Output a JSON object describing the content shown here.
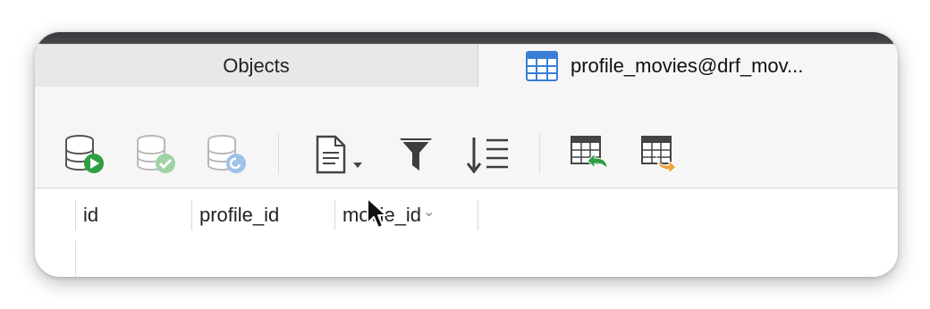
{
  "tabs": [
    {
      "label": "Objects",
      "active": false
    },
    {
      "label": "profile_movies@drf_mov...",
      "active": true,
      "icon": "table-grid-icon"
    }
  ],
  "toolbar": {
    "buttons": [
      {
        "name": "begin-transaction",
        "icon": "database-play-icon"
      },
      {
        "name": "commit",
        "icon": "database-check-icon"
      },
      {
        "name": "rollback",
        "icon": "database-undo-icon"
      },
      {
        "name": "text-view",
        "icon": "document-dropdown-icon"
      },
      {
        "name": "filter",
        "icon": "funnel-icon"
      },
      {
        "name": "sort",
        "icon": "sort-lines-icon"
      },
      {
        "name": "import",
        "icon": "table-import-icon"
      },
      {
        "name": "export",
        "icon": "table-export-icon"
      }
    ]
  },
  "grid": {
    "columns": [
      "id",
      "profile_id",
      "movie_id"
    ],
    "sort_indicator": "⌄"
  },
  "colors": {
    "accent_green": "#3aa64b",
    "accent_blue": "#4a8fd8",
    "export_orange": "#f0a03c"
  }
}
